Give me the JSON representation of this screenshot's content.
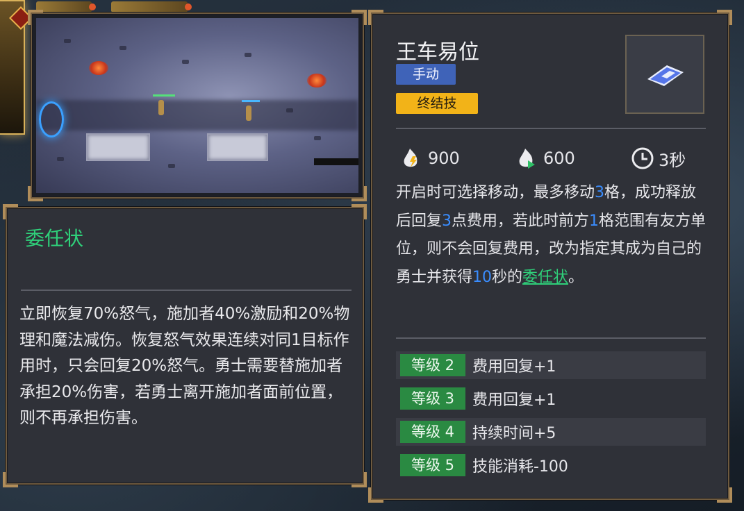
{
  "skill": {
    "name": "王车易位",
    "tags": {
      "manual": "手动",
      "ultimate": "终结技"
    },
    "icon": "swap-tile-icon",
    "stats": [
      {
        "icon": "flame-lightning-icon",
        "value": "900"
      },
      {
        "icon": "flame-arrow-icon",
        "value": "600"
      },
      {
        "icon": "clock-icon",
        "value": "3秒"
      }
    ],
    "description": {
      "p1": "开启时可选择移动，最多移动",
      "n1": "3",
      "p2": "格，成功释放后回复",
      "n2": "3",
      "p3": "点费用，若此时前方",
      "n3": "1",
      "p4": "格范围有友方单位，则不会回复费用，改为指定其成为自己的勇士并获得",
      "n4": "10",
      "p5": "秒的",
      "link": "委任状",
      "p6": "。"
    },
    "levels": [
      {
        "label": "等级 2",
        "text": "费用回复+1"
      },
      {
        "label": "等级 3",
        "text": "费用回复+1"
      },
      {
        "label": "等级 4",
        "text": "持续时间+5"
      },
      {
        "label": "等级 5",
        "text": "技能消耗-100"
      }
    ]
  },
  "effect": {
    "title": "委任状",
    "description": "立即恢复70%怒气，施加者40%激励和20%物理和魔法减伤。恢复怒气效果连续对同1目标作用时，只会回复20%怒气。勇士需要替施加者承担20%伤害，若勇士离开施加者面前位置，则不再承担伤害。"
  },
  "colors": {
    "manual_tag": "#3f63b8",
    "ultimate_tag": "#f2b318",
    "level_badge": "#2a8a42",
    "highlight_number": "#3a8dff",
    "effect_title": "#2fd07a"
  }
}
